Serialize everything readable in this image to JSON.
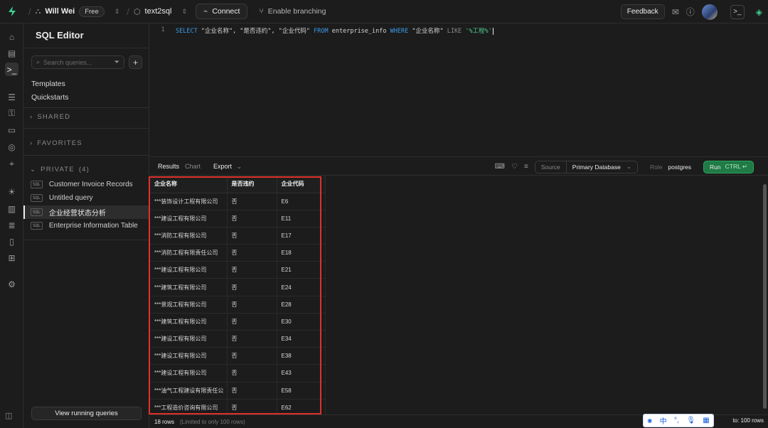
{
  "topbar": {
    "org_name": "Will Wei",
    "plan": "Free",
    "project": "text2sql",
    "connect_label": "Connect",
    "branching_label": "Enable branching",
    "feedback_label": "Feedback"
  },
  "sidebar": {
    "title": "SQL Editor",
    "search_placeholder": "Search queries...",
    "links": [
      "Templates",
      "Quickstarts"
    ],
    "sections": {
      "shared": "SHARED",
      "favorites": "FAVORITES",
      "private": "PRIVATE",
      "private_count": "(4)"
    },
    "items": [
      {
        "label": "Customer Invoice Records"
      },
      {
        "label": "Untitled query"
      },
      {
        "label": "企业经营状态分析"
      },
      {
        "label": "Enterprise Information Table"
      }
    ],
    "sql_tag": "SQL",
    "bottom_button": "View running queries"
  },
  "editor": {
    "line_number": "1",
    "tokens": {
      "select": "SELECT",
      "cols": " \"企业名称\", \"是否违约\", \"企业代码\" ",
      "from": "FROM",
      "table": " enterprise_info ",
      "where": "WHERE",
      "col": " \"企业名称\" ",
      "like": "LIKE",
      "pattern": " '%工程%'"
    }
  },
  "results": {
    "tabs": [
      "Results",
      "Chart"
    ],
    "export_label": "Export",
    "source_label": "Source",
    "source_value": "Primary Database",
    "role_label": "Role",
    "role_value": "postgres",
    "run_label": "Run",
    "run_shortcut": "CTRL ↵"
  },
  "grid": {
    "columns": [
      "企业名称",
      "是否违约",
      "企业代码"
    ],
    "rows": [
      [
        "***装饰设计工程有限公司",
        "否",
        "E6"
      ],
      [
        "***建设工程有限公司",
        "否",
        "E11"
      ],
      [
        "***消防工程有限公司",
        "否",
        "E17"
      ],
      [
        "***消防工程有限责任公司",
        "否",
        "E18"
      ],
      [
        "***建设工程有限公司",
        "否",
        "E21"
      ],
      [
        "***建筑工程有限公司",
        "否",
        "E24"
      ],
      [
        "***景观工程有限公司",
        "否",
        "E28"
      ],
      [
        "***建筑工程有限公司",
        "否",
        "E30"
      ],
      [
        "***建设工程有限公司",
        "否",
        "E34"
      ],
      [
        "***建设工程有限公司",
        "否",
        "E38"
      ],
      [
        "***建设工程有限公司",
        "否",
        "E43"
      ],
      [
        "***油气工程建设有限责任公",
        "否",
        "E58"
      ],
      [
        "***工程造价咨询有限公司",
        "否",
        "E62"
      ]
    ]
  },
  "footer": {
    "rows_count": "18 rows",
    "rows_note": "(Limited to only 100 rows)",
    "limit_right": "to: 100 rows"
  },
  "ime": {
    "lang": "中"
  },
  "colors": {
    "accent_green": "#3ecf8e",
    "run_button": "#1f7a45",
    "highlight_red": "#e0302c"
  }
}
